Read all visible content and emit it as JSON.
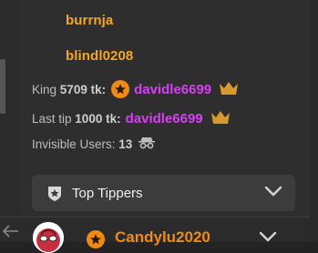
{
  "viewers": [
    "burrnja",
    "blindl0208"
  ],
  "king": {
    "label": "King",
    "amount": "5709 tk:",
    "username": "davidle6699",
    "badge_icon": "star-badge",
    "trophy_icon": "crown-icon"
  },
  "last_tip": {
    "label": "Last tip",
    "amount": "1000 tk:",
    "username": "davidle6699",
    "trophy_icon": "crown-icon"
  },
  "invisible": {
    "label": "Invisible Users:",
    "count": "13",
    "icon": "spy-icon"
  },
  "top_tippers": {
    "label": "Top Tippers",
    "icon": "shield-star-icon",
    "expand_icon": "chevron-down-icon"
  },
  "bottom_user": {
    "name": "Candylu2020",
    "badge_icon": "star-badge"
  },
  "colors": {
    "viewer_name": "#f6a523",
    "username": "#d63ff3",
    "crown": "#d89a2c",
    "badge": "#f18a13"
  }
}
